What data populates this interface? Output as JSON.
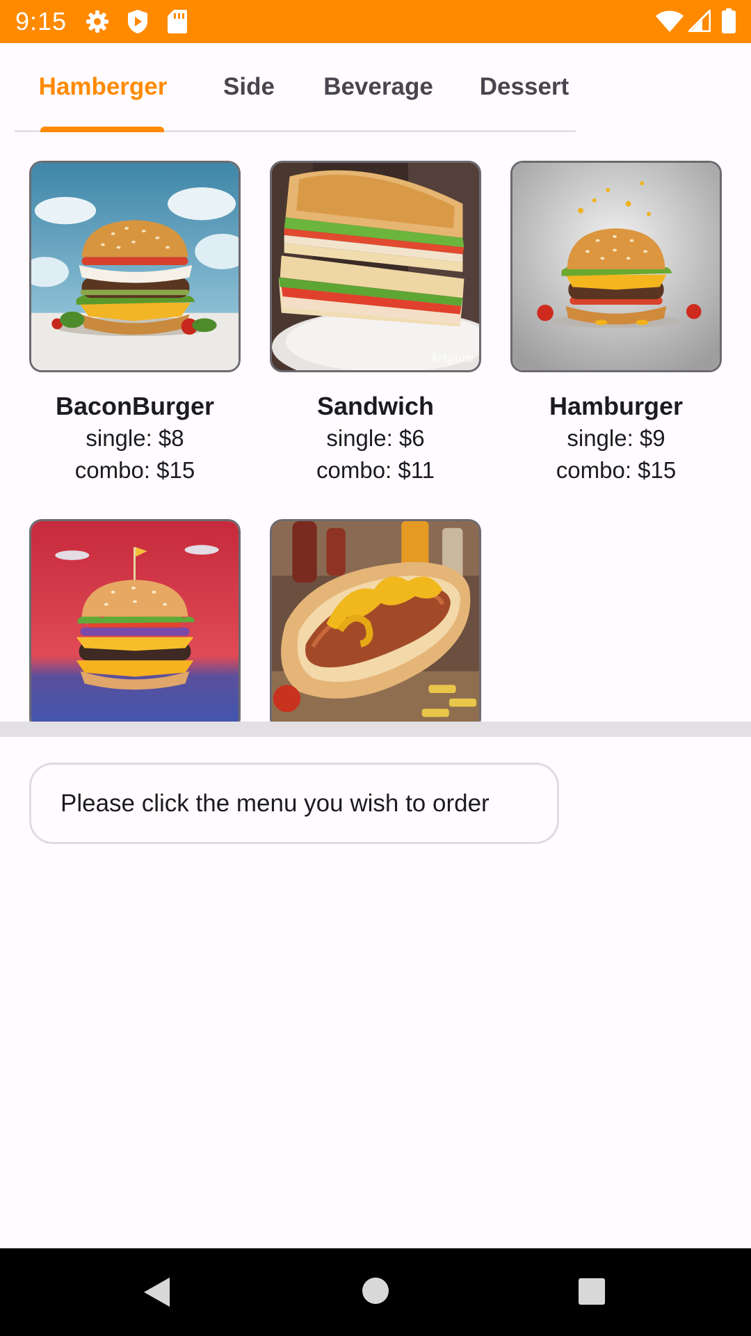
{
  "status_bar": {
    "time": "9:15",
    "left_icons": [
      "gear-icon",
      "play-shield-icon",
      "sd-card-icon"
    ],
    "right_icons": [
      "wifi-icon",
      "cell-signal-icon",
      "battery-icon"
    ],
    "background": "#ff8a00"
  },
  "tabs": [
    {
      "label": "Hamberger",
      "active": true
    },
    {
      "label": "Side",
      "active": false
    },
    {
      "label": "Beverage",
      "active": false
    },
    {
      "label": "Dessert",
      "active": false
    }
  ],
  "accent_color": "#ff8a00",
  "menu_items": [
    {
      "name": "BaconBurger",
      "single": "single: $8",
      "combo": "combo: $15",
      "image": "bacon-burger-photo"
    },
    {
      "name": "Sandwich",
      "single": "single: $6",
      "combo": "combo: $11",
      "image": "sandwich-photo",
      "watermark": "Artguru"
    },
    {
      "name": "Hamburger",
      "single": "single: $9",
      "combo": "combo: $15",
      "image": "hamburger-photo"
    },
    {
      "name": "",
      "image": "cheeseburger-photo"
    },
    {
      "name": "",
      "image": "hotdog-photo"
    }
  ],
  "order_hint": "Please click the menu you wish to order",
  "nav_bar": {
    "buttons": [
      "back-icon",
      "home-icon",
      "recents-icon"
    ]
  }
}
